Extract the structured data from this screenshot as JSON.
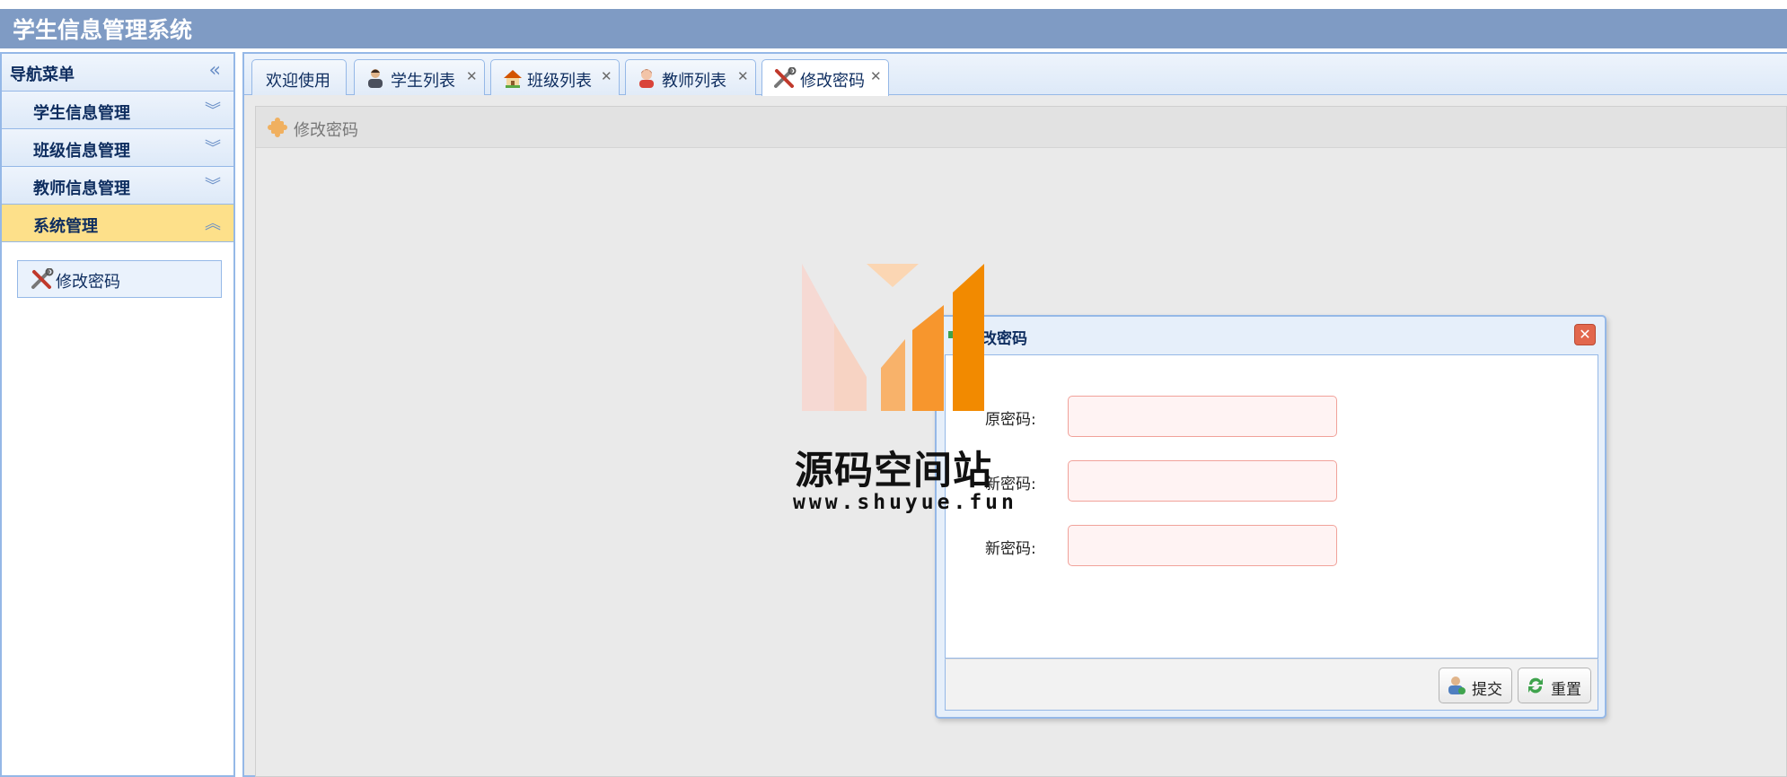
{
  "app": {
    "title": "学生信息管理系统"
  },
  "sidebar": {
    "title": "导航菜单",
    "sections": [
      {
        "label": "学生信息管理",
        "expanded": false
      },
      {
        "label": "班级信息管理",
        "expanded": false
      },
      {
        "label": "教师信息管理",
        "expanded": false
      },
      {
        "label": "系统管理",
        "expanded": true
      }
    ],
    "links": [
      {
        "label": "修改密码",
        "icon": "tools-icon"
      }
    ]
  },
  "tabs": [
    {
      "label": "欢迎使用",
      "closable": false
    },
    {
      "label": "学生列表",
      "icon": "student-icon",
      "closable": true
    },
    {
      "label": "班级列表",
      "icon": "house-icon",
      "closable": true
    },
    {
      "label": "教师列表",
      "icon": "teacher-icon",
      "closable": true
    },
    {
      "label": "修改密码",
      "icon": "tools-icon",
      "closable": true,
      "active": true
    }
  ],
  "content": {
    "title": "修改密码"
  },
  "dialog": {
    "title": "改密码",
    "fields": [
      {
        "label": "原密码:",
        "value": ""
      },
      {
        "label": "新密码:",
        "value": ""
      },
      {
        "label": "新密码:",
        "value": ""
      }
    ],
    "buttons": {
      "submit": "提交",
      "reset": "重置"
    }
  },
  "watermark": {
    "title": "源码空间站",
    "url": "www.shuyue.fun"
  },
  "colors": {
    "header": "#7f9bc4",
    "border": "#95b8e7",
    "active_section": "#fde08a",
    "invalid_field": "#fff3f3"
  }
}
